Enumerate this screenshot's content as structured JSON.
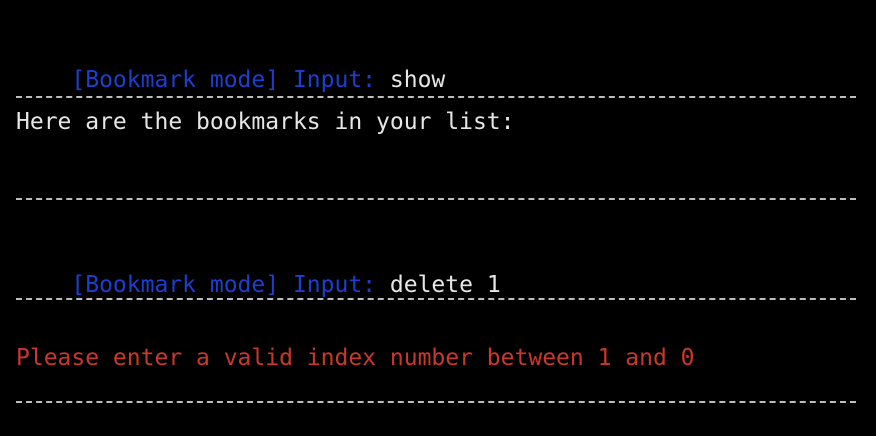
{
  "terminal": {
    "colors": {
      "background": "#000000",
      "prompt": "#1d3ed0",
      "text": "#e6e6e6",
      "error": "#c9382a",
      "divider": "#bdbdbd"
    },
    "lines": {
      "prompt1": {
        "prefix": "[Bookmark mode] Input: ",
        "command": "show"
      },
      "output_list_header": "Here are the bookmarks in your list:",
      "prompt2": {
        "prefix": "[Bookmark mode] Input: ",
        "command": "delete 1"
      },
      "error_message": "Please enter a valid index number between 1 and 0"
    }
  }
}
